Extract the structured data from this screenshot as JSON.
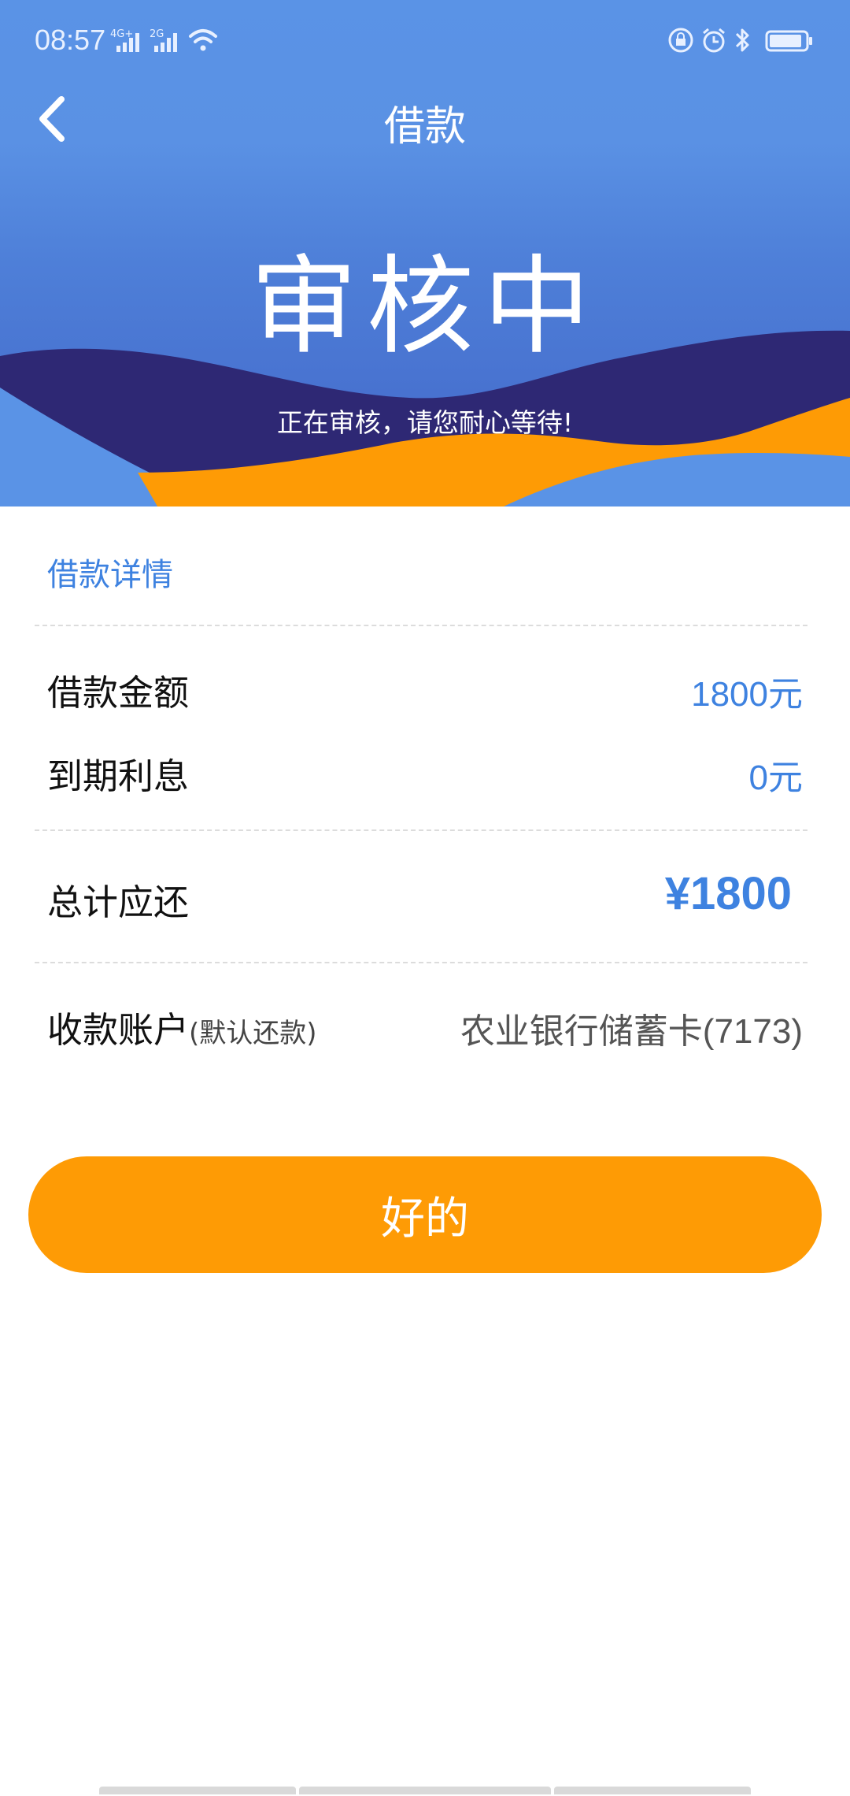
{
  "status_bar": {
    "time": "08:57",
    "network_1": "4G+",
    "network_2": "2G",
    "icons": [
      "signal-icon",
      "signal-icon",
      "wifi-icon",
      "rotation-lock-icon",
      "alarm-icon",
      "bluetooth-icon",
      "battery-icon"
    ]
  },
  "nav": {
    "title": "借款",
    "back_icon": "chevron-left-icon"
  },
  "hero": {
    "status": "审核中",
    "message": "正在审核，请您耐心等待!"
  },
  "details": {
    "title": "借款详情",
    "loan_amount_label": "借款金额",
    "loan_amount_value": "1800元",
    "interest_label": "到期利息",
    "interest_value": "0元",
    "total_label": "总计应还",
    "total_value": "¥1800",
    "account_label": "收款账户",
    "account_hint": "(默认还款)",
    "account_value": "农业银行储蓄卡(7173)"
  },
  "actions": {
    "ok_label": "好的"
  },
  "colors": {
    "header_blue": "#5a93e6",
    "wave_navy": "#2e2874",
    "wave_orange": "#fe9b05",
    "accent_blue": "#3e82e0",
    "button_orange": "#fe9b05"
  }
}
